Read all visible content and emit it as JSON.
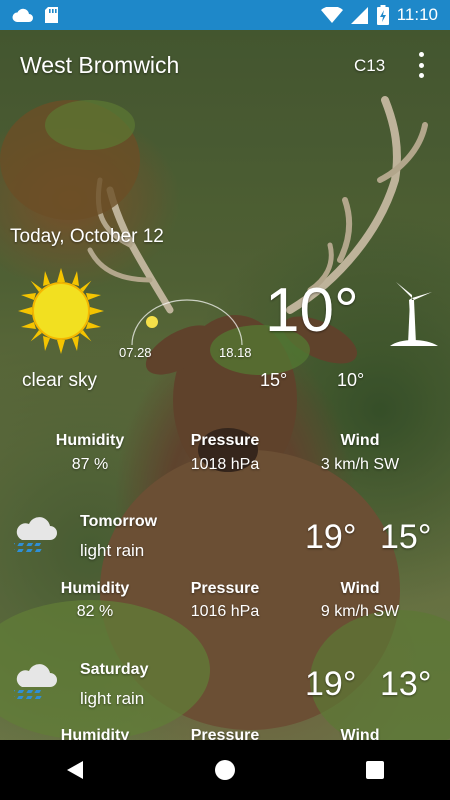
{
  "status_bar": {
    "time": "11:10",
    "icons": [
      "cloud-icon",
      "sd-card-icon",
      "wifi-icon",
      "signal-icon",
      "battery-charging-icon"
    ]
  },
  "header": {
    "city": "West Bromwich",
    "code": "C13"
  },
  "today": {
    "date": "Today, October 12",
    "sunrise": "07.28",
    "sunset": "18.18",
    "temperature": "10°",
    "condition": "clear sky",
    "high": "15°",
    "low": "10°",
    "humidity_label": "Humidity",
    "humidity": "87 %",
    "pressure_label": "Pressure",
    "pressure": "1018 hPa",
    "wind_label": "Wind",
    "wind": "3 km/h SW",
    "icon": "sun-icon",
    "wind_icon": "wind-turbine-icon"
  },
  "forecast": [
    {
      "day": "Tomorrow",
      "condition": "light rain",
      "high": "19°",
      "low": "15°",
      "humidity_label": "Humidity",
      "humidity": "82 %",
      "pressure_label": "Pressure",
      "pressure": "1016 hPa",
      "wind_label": "Wind",
      "wind": "9 km/h SW",
      "icon": "rain-cloud-icon"
    },
    {
      "day": "Saturday",
      "condition": "light rain",
      "high": "19°",
      "low": "13°",
      "humidity_label": "Humidity",
      "pressure_label": "Pressure",
      "wind_label": "Wind",
      "icon": "rain-cloud-icon"
    }
  ],
  "colors": {
    "status_bar": "#1e88c9",
    "sun": "#f5c400",
    "rain_drops": "#2f8fd6"
  }
}
